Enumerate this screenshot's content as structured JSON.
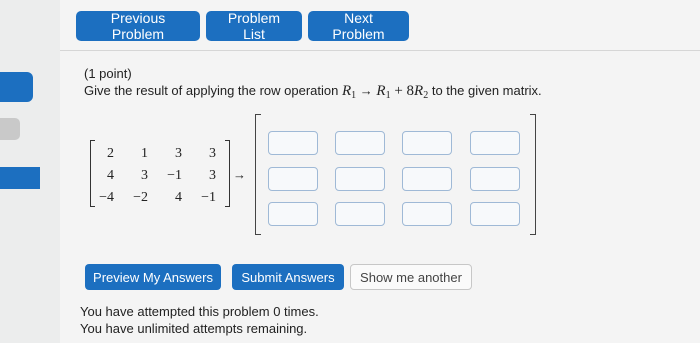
{
  "nav": {
    "previous": "Previous Problem",
    "list": "Problem List",
    "next": "Next Problem"
  },
  "problem": {
    "points": "(1 point)",
    "prompt_before": "Give the result of applying the row operation ",
    "op_lhs": "R",
    "op_lhs_sub": "1",
    "op_arrow": "→",
    "op_rhs1": "R",
    "op_rhs1_sub": "1",
    "op_plus": " + 8",
    "op_rhs2": "R",
    "op_rhs2_sub": "2",
    "prompt_after": " to the given matrix."
  },
  "matrix": {
    "rows": [
      [
        "2",
        "1",
        "3",
        "3"
      ],
      [
        "4",
        "3",
        "−1",
        "3"
      ],
      [
        "−4",
        "−2",
        "4",
        "−1"
      ]
    ],
    "arrow": "→"
  },
  "actions": {
    "preview": "Preview My Answers",
    "submit": "Submit Answers",
    "show_another": "Show me another"
  },
  "status": {
    "attempted": "You have attempted this problem 0 times.",
    "remaining": "You have unlimited attempts remaining."
  },
  "colors": {
    "button_blue": "#1c6fc0"
  }
}
